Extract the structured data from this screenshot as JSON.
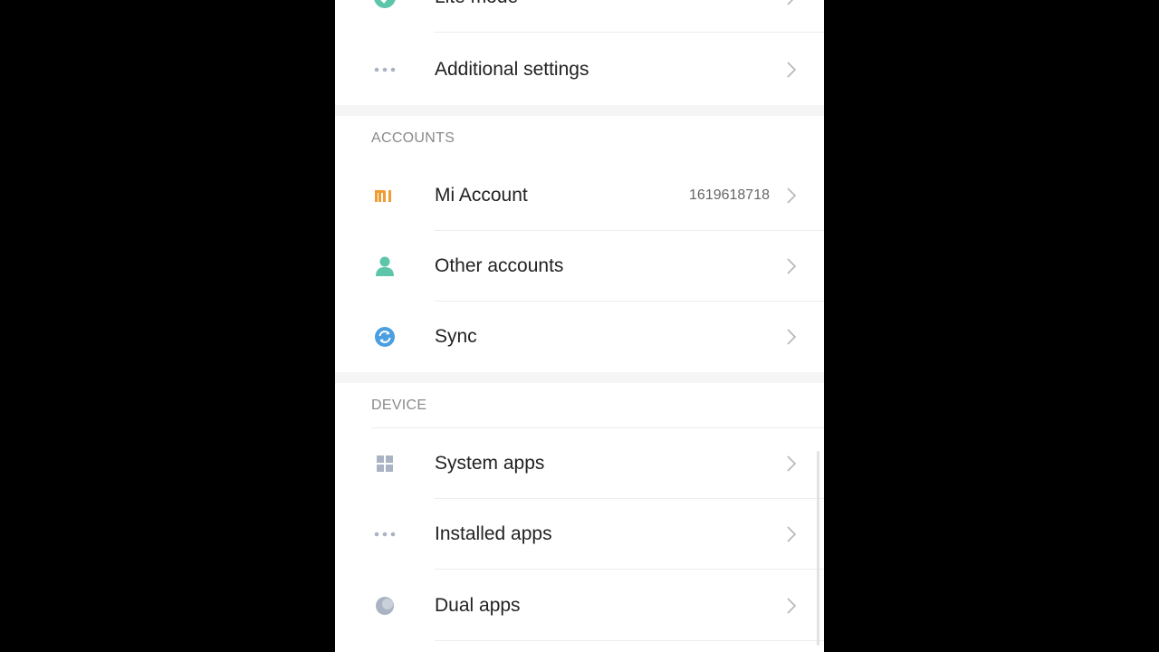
{
  "colors": {
    "background": "#000000",
    "panel": "#ffffff",
    "section_gap": "#f5f5f5",
    "text_primary": "#222222",
    "text_secondary": "#8a8a8a",
    "mi_orange": "#f19b33",
    "person_teal": "#5cc5aa",
    "sync_blue": "#4a9fe0"
  },
  "top_item": {
    "label": "Lite mode",
    "icon": "lite-mode-icon"
  },
  "additional": {
    "label": "Additional settings",
    "icon": "more-dots-icon"
  },
  "accounts": {
    "header": "ACCOUNTS",
    "items": [
      {
        "label": "Mi Account",
        "value": "1619618718",
        "icon": "mi-logo-icon"
      },
      {
        "label": "Other accounts",
        "value": "",
        "icon": "person-icon"
      },
      {
        "label": "Sync",
        "value": "",
        "icon": "sync-icon"
      }
    ]
  },
  "device": {
    "header": "DEVICE",
    "items": [
      {
        "label": "System apps",
        "icon": "grid-icon"
      },
      {
        "label": "Installed apps",
        "icon": "more-dots-icon"
      },
      {
        "label": "Dual apps",
        "icon": "dual-apps-icon"
      }
    ]
  },
  "mi_logo_text": "mi"
}
